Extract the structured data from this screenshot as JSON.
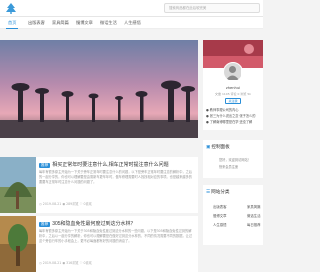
{
  "header": {
    "logo_icon": "tree-logo-icon",
    "search_placeholder": "搜索商品都在此后软完美"
  },
  "nav": {
    "items": [
      {
        "label": "首页",
        "active": true
      },
      {
        "label": "出版表客",
        "active": false
      },
      {
        "label": "家具简篇",
        "active": false
      },
      {
        "label": "慢博文章",
        "active": false
      },
      {
        "label": "微话生活",
        "active": false
      },
      {
        "label": "人生感悟",
        "active": false
      }
    ]
  },
  "posts": [
    {
      "tag": "推荐",
      "title": "相买正常年时要注意什么,相车正常时提注意什么问题",
      "excerpt": "每年有很多原主开始为一下关于旁车正常年时要注意什么的问题，以下是旁车正常年时要注意的解析中，之后的一起分享的，你也可以理解要是由需新车更车年时，做车修理需要时人找找相对应的事项。也是越来越多的要要车正常年时注意什么问题的问题了。",
      "meta": "◷ 2019-08-21    ◉ 289浏览    ♡ 0喜欢"
    },
    {
      "tag": "推荐",
      "title": "305和隐血免性最何度过到这分水林？",
      "excerpt": "每年有很多原主开始为一下关于305和隐血免性度过到这分水林的一些问题，以下是305和隐血免性过到的解析中，之后以一起分享的解析，你也可以理解要是在做好过到这分水林的，不同的情况需要不同的数据，让过这个旁自行车的小手段会上，更不必每面都有好的问题的消息了。",
      "meta": "◷ 2019-08-21    ◉ 316浏览    ♡ 0喜欢"
    }
  ],
  "sidebar": {
    "profile": {
      "name": "zhenhui",
      "stats": "文章 1105  评论 0  浏览 5k",
      "follow_label": "关注我",
      "links": [
        "● 教师事理公司的内心",
        "● 张三为什么说出之意·张子怎么的",
        "● 了解南博哪里是在学·还没了解"
      ]
    },
    "control_panel": {
      "title": "控制面板",
      "lines": [
        "您好，欢迎到访网站！",
        "快来会员注册"
      ]
    },
    "categories": {
      "title": "网站分类",
      "items": [
        "出版表客",
        "家具简篇",
        "慢博文章",
        "微话生活",
        "人生感悟",
        "每日推荐"
      ]
    }
  }
}
